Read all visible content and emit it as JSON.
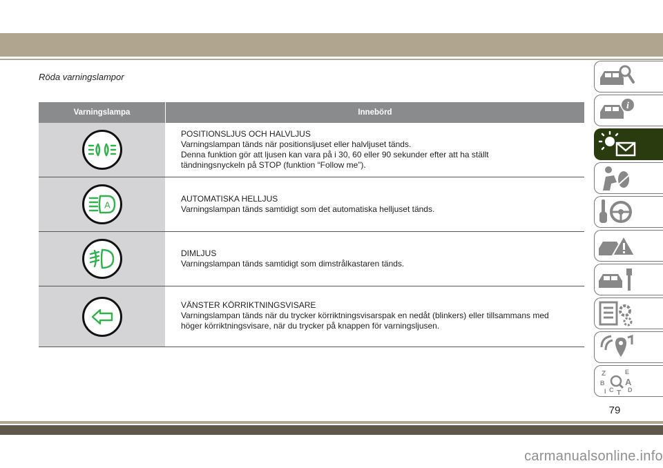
{
  "section_title": "Röda varningslampor",
  "table": {
    "headers": [
      "Varningslampa",
      "Innebörd"
    ],
    "rows": [
      {
        "icon": "position-lights-icon",
        "title": "POSITIONSLJUS OCH HALVLJUS",
        "lines": [
          "Varningslampan tänds när positionsljuset eller halvljuset tänds.",
          "Denna funktion gör att ljusen kan vara på i 30, 60 eller 90 sekunder efter att ha ställt",
          "tändningsnyckeln på STOP (funktion “Follow me”)."
        ]
      },
      {
        "icon": "auto-high-beam-icon",
        "title": "AUTOMATISKA HELLJUS",
        "lines": [
          "Varningslampan tänds samtidigt som det automatiska helljuset tänds."
        ]
      },
      {
        "icon": "fog-light-icon",
        "title": "DIMLJUS",
        "lines": [
          "Varningslampan tänds samtidigt som dimstrålkastaren tänds."
        ]
      },
      {
        "icon": "left-turn-signal-icon",
        "title": "VÄNSTER KÖRRIKTNINGSVISARE",
        "lines": [
          "Varningslampan tänds när du trycker körriktningsvisarspak en nedåt (blinkers) eller tillsammans med",
          "höger körriktningsvisare, när du trycker på knappen för varningsljusen."
        ]
      }
    ]
  },
  "side_tabs": [
    "car-search-icon",
    "car-info-icon",
    "warning-light-envelope-icon",
    "airbag-person-icon",
    "key-steering-wheel-icon",
    "car-warning-icon",
    "car-wrench-icon",
    "specs-gear-icon",
    "music-navigation-icon",
    "alphabet-index-icon"
  ],
  "page_number": "79",
  "watermark": "carmanualsonline.info",
  "colors": {
    "accent_green": "#2db34a",
    "header_gray": "#8a8b8d",
    "icon_cell_gray": "#d4d4d6",
    "active_tab": "#2b3b10",
    "band_tan": "#b0a690"
  }
}
